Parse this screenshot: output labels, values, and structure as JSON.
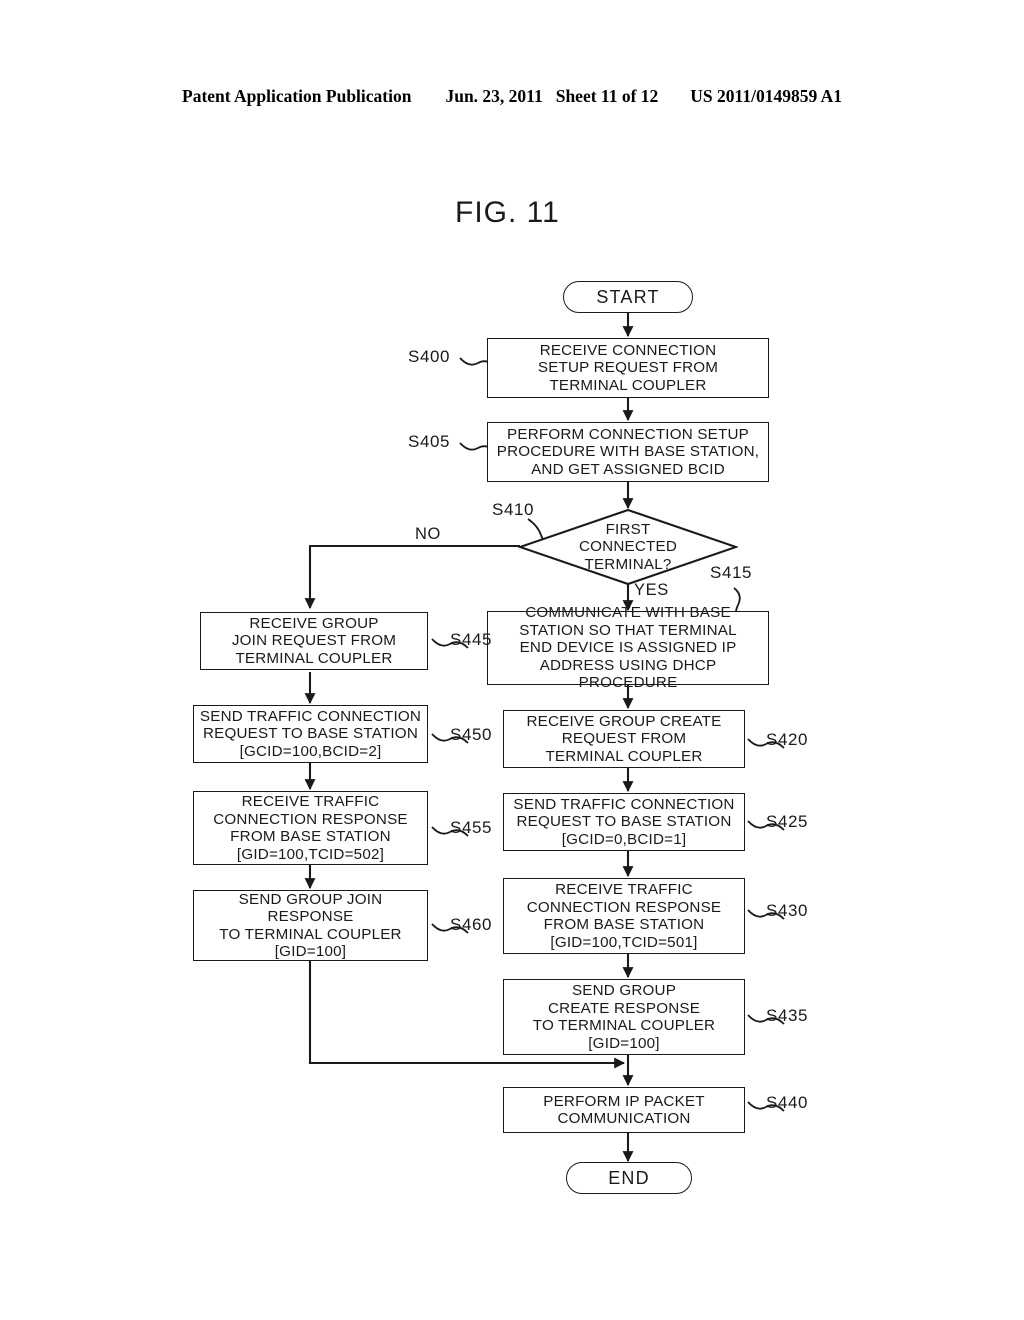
{
  "header": {
    "publication": "Patent Application Publication",
    "date": "Jun. 23, 2011",
    "sheet": "Sheet 11 of 12",
    "number": "US 2011/0149859 A1"
  },
  "figure": {
    "title": "FIG. 11"
  },
  "flow": {
    "start": {
      "label": "START"
    },
    "end": {
      "label": "END"
    },
    "s400": {
      "ref": "S400",
      "lines": [
        "RECEIVE CONNECTION",
        "SETUP REQUEST FROM",
        "TERMINAL COUPLER"
      ]
    },
    "s405": {
      "ref": "S405",
      "lines": [
        "PERFORM CONNECTION SETUP",
        "PROCEDURE WITH BASE STATION,",
        "AND GET ASSIGNED BCID"
      ]
    },
    "s410": {
      "ref": "S410",
      "lines": [
        "FIRST",
        "CONNECTED",
        "TERMINAL?"
      ],
      "branch_no": "NO",
      "branch_yes": "YES"
    },
    "s415": {
      "ref": "S415",
      "lines": [
        "COMMUNICATE WITH BASE",
        "STATION SO THAT TERMINAL",
        "END DEVICE IS ASSIGNED IP",
        "ADDRESS USING DHCP PROCEDURE"
      ]
    },
    "s420": {
      "ref": "S420",
      "lines": [
        "RECEIVE GROUP CREATE",
        "REQUEST FROM",
        "TERMINAL COUPLER"
      ]
    },
    "s425": {
      "ref": "S425",
      "lines": [
        "SEND TRAFFIC CONNECTION",
        "REQUEST TO BASE STATION",
        "[GCID=0,BCID=1]"
      ]
    },
    "s430": {
      "ref": "S430",
      "lines": [
        "RECEIVE TRAFFIC",
        "CONNECTION RESPONSE",
        "FROM BASE STATION",
        "[GID=100,TCID=501]"
      ]
    },
    "s435": {
      "ref": "S435",
      "lines": [
        "SEND GROUP",
        "CREATE RESPONSE",
        "TO TERMINAL COUPLER",
        "[GID=100]"
      ]
    },
    "s440": {
      "ref": "S440",
      "lines": [
        "PERFORM IP PACKET",
        "COMMUNICATION"
      ]
    },
    "s445": {
      "ref": "S445",
      "lines": [
        "RECEIVE GROUP",
        "JOIN REQUEST FROM",
        "TERMINAL COUPLER"
      ]
    },
    "s450": {
      "ref": "S450",
      "lines": [
        "SEND TRAFFIC CONNECTION",
        "REQUEST TO BASE STATION",
        "[GCID=100,BCID=2]"
      ]
    },
    "s455": {
      "ref": "S455",
      "lines": [
        "RECEIVE TRAFFIC",
        "CONNECTION RESPONSE",
        "FROM BASE STATION",
        "[GID=100,TCID=502]"
      ]
    },
    "s460": {
      "ref": "S460",
      "lines": [
        "SEND GROUP JOIN",
        "RESPONSE",
        "TO TERMINAL COUPLER",
        "[GID=100]"
      ]
    }
  },
  "colors": {
    "ink": "#1a1a1a",
    "paper": "#ffffff"
  }
}
